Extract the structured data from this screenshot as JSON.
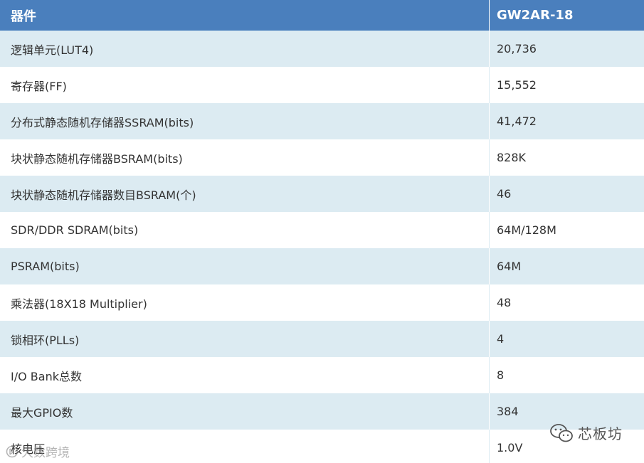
{
  "table": {
    "header": [
      "器件",
      "GW2AR-18"
    ],
    "rows": [
      [
        "逻辑单元(LUT4)",
        "20,736"
      ],
      [
        "寄存器(FF)",
        "15,552"
      ],
      [
        "分布式静态随机存储器SSRAM(bits)",
        "41,472"
      ],
      [
        "块状静态随机存储器BSRAM(bits)",
        "828K"
      ],
      [
        "块状静态随机存储器数目BSRAM(个)",
        "46"
      ],
      [
        "SDR/DDR SDRAM(bits)",
        "64M/128M"
      ],
      [
        "PSRAM(bits)",
        "64M"
      ],
      [
        "乘法器(18X18 Multiplier)",
        "48"
      ],
      [
        "锁相环(PLLs)",
        "4"
      ],
      [
        "I/O Bank总数",
        "8"
      ],
      [
        "最大GPIO数",
        "384"
      ],
      [
        "核电压",
        "1.0V"
      ]
    ]
  },
  "watermarks": {
    "right_text": "芯板坊",
    "right_icon": "wechat-icon",
    "left_text": "大数跨境",
    "left_icon": "brand-logo-icon"
  },
  "colors": {
    "header_bg": "#4a7fbd",
    "odd_row_bg": "#dcebf2",
    "even_row_bg": "#ffffff"
  }
}
